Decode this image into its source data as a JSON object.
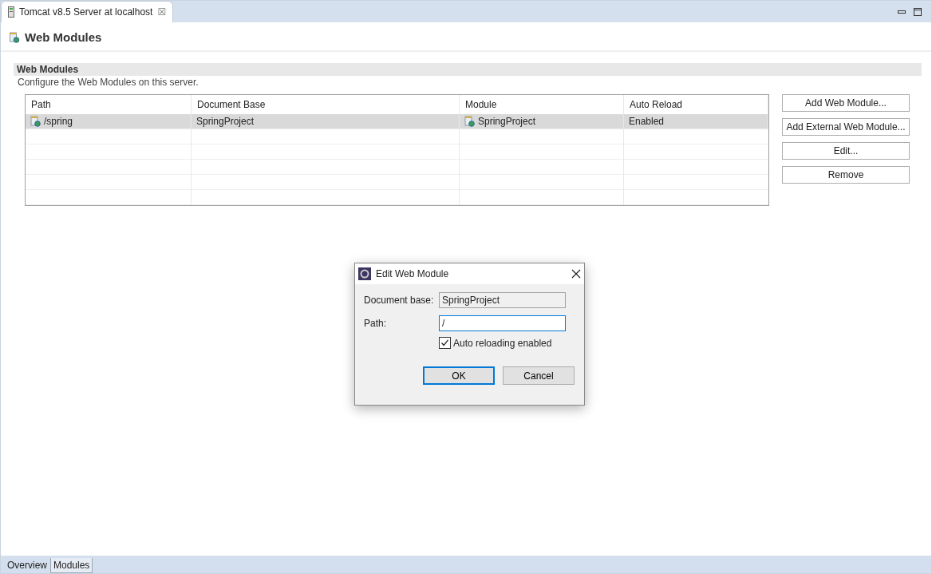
{
  "editor_tab": {
    "title": "Tomcat v8.5 Server at localhost",
    "close": "☒"
  },
  "page_title": "Web Modules",
  "section": {
    "title": "Web Modules",
    "description": "Configure the Web Modules on this server."
  },
  "table": {
    "columns": [
      "Path",
      "Document Base",
      "Module",
      "Auto Reload"
    ],
    "rows": [
      {
        "path": "/spring",
        "document_base": "SpringProject",
        "module": "SpringProject",
        "auto_reload": "Enabled",
        "selected": true
      }
    ]
  },
  "buttons": [
    "Add Web Module...",
    "Add External Web Module...",
    "Edit...",
    "Remove"
  ],
  "dialog": {
    "title": "Edit Web Module",
    "fields": [
      {
        "label": "Document base:",
        "value": "SpringProject",
        "disabled": true,
        "focused": false
      },
      {
        "label": "Path:",
        "value": "/",
        "disabled": false,
        "focused": true
      }
    ],
    "checkbox": {
      "label": "Auto reloading enabled",
      "checked": true
    },
    "buttons": [
      {
        "label": "OK",
        "default": true
      },
      {
        "label": "Cancel",
        "default": false
      }
    ]
  },
  "bottom_tabs": [
    {
      "label": "Overview",
      "selected": false
    },
    {
      "label": "Modules",
      "selected": true
    }
  ]
}
